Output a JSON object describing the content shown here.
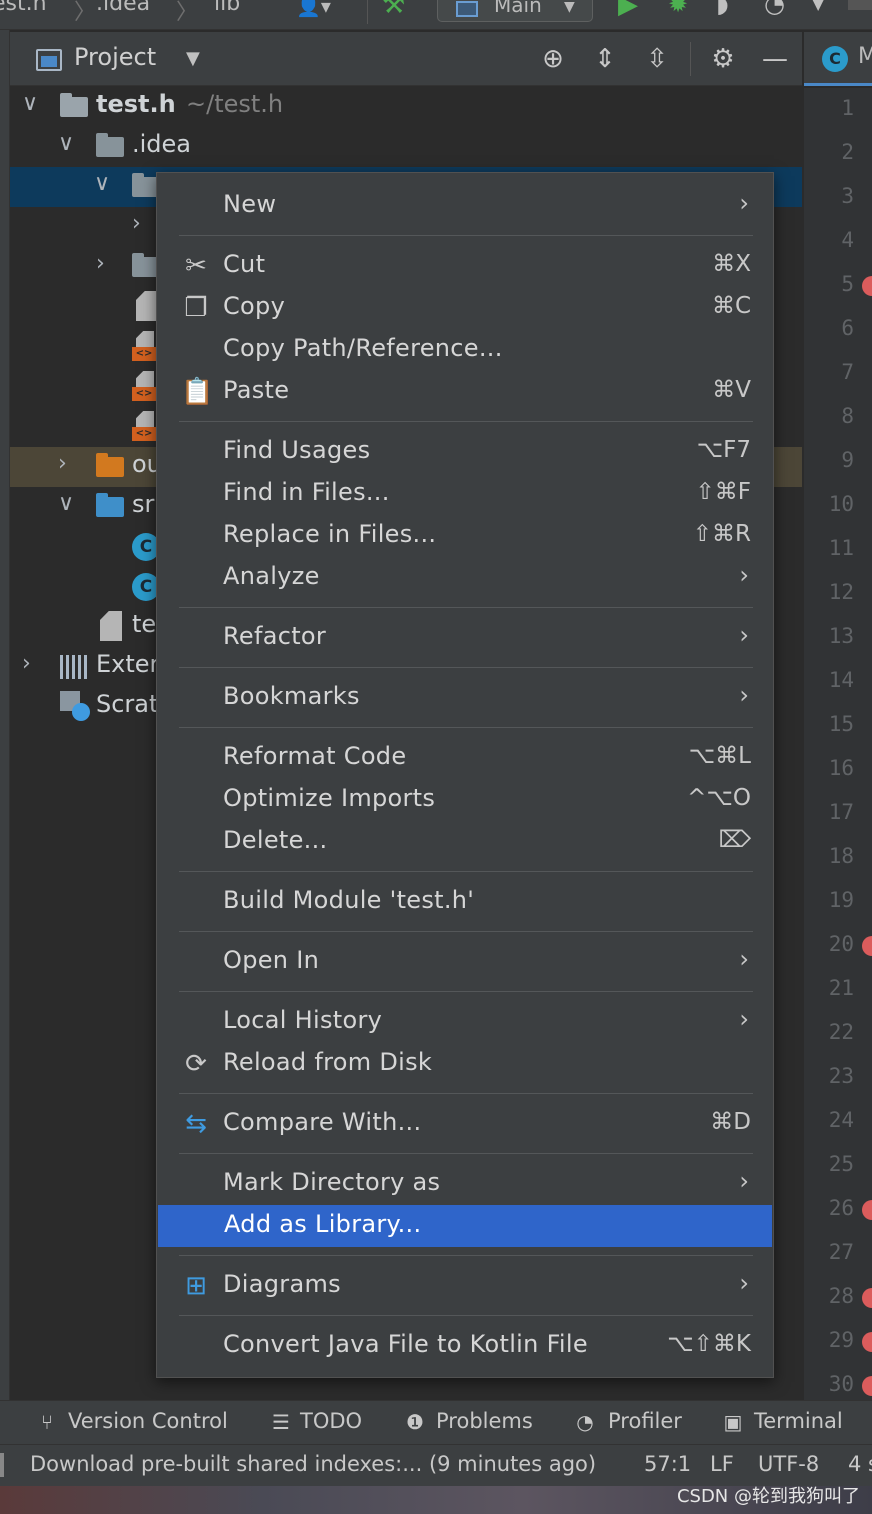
{
  "navbar": {
    "crumbs": [
      "est.h",
      ".idea",
      "lib"
    ],
    "branch": "Main"
  },
  "project_pane": {
    "title": "Project"
  },
  "tree": {
    "root_name": "test.h",
    "root_path": "~/test.h",
    "idea": ".idea",
    "out": "ou",
    "src": "sr",
    "file_te": "te",
    "external": "Exter",
    "scratches": "Scrat"
  },
  "editor": {
    "tab_letter": "C",
    "tab_label": "M",
    "line_numbers": [
      "1",
      "2",
      "3",
      "4",
      "5",
      "6",
      "7",
      "8",
      "9",
      "10",
      "11",
      "12",
      "13",
      "14",
      "15",
      "16",
      "17",
      "18",
      "19",
      "20",
      "21",
      "22",
      "23",
      "24",
      "25",
      "26",
      "27",
      "28",
      "29",
      "30"
    ]
  },
  "context_menu": {
    "items": [
      {
        "label": "New",
        "shortcut": "",
        "submenu": true
      },
      {
        "label": "Cut",
        "shortcut": "⌘X",
        "icon": "scissors-icon"
      },
      {
        "label": "Copy",
        "shortcut": "⌘C",
        "icon": "copy-icon"
      },
      {
        "label": "Copy Path/Reference...",
        "shortcut": ""
      },
      {
        "label": "Paste",
        "shortcut": "⌘V",
        "icon": "clipboard-icon"
      },
      {
        "label": "Find Usages",
        "shortcut": "⌥F7"
      },
      {
        "label": "Find in Files...",
        "shortcut": "⇧⌘F"
      },
      {
        "label": "Replace in Files...",
        "shortcut": "⇧⌘R"
      },
      {
        "label": "Analyze",
        "submenu": true
      },
      {
        "label": "Refactor",
        "submenu": true
      },
      {
        "label": "Bookmarks",
        "submenu": true
      },
      {
        "label": "Reformat Code",
        "shortcut": "⌥⌘L"
      },
      {
        "label": "Optimize Imports",
        "shortcut": "^⌥O"
      },
      {
        "label": "Delete...",
        "shortcut": "⌦"
      },
      {
        "label": "Build Module 'test.h'",
        "shortcut": ""
      },
      {
        "label": "Open In",
        "submenu": true
      },
      {
        "label": "Local History",
        "submenu": true
      },
      {
        "label": "Reload from Disk",
        "icon": "reload-icon"
      },
      {
        "label": "Compare With...",
        "shortcut": "⌘D",
        "icon": "compare-icon"
      },
      {
        "label": "Mark Directory as",
        "submenu": true
      },
      {
        "label": "Add as Library...",
        "active": true
      },
      {
        "label": "Diagrams",
        "submenu": true,
        "icon": "diagram-icon"
      },
      {
        "label": "Convert Java File to Kotlin File",
        "shortcut": "⌥⇧⌘K"
      }
    ],
    "arrow": "›"
  },
  "tool_windows": {
    "version_control": "Version Control",
    "todo": "TODO",
    "problems": "Problems",
    "profiler": "Profiler",
    "terminal": "Terminal"
  },
  "status": {
    "message": "Download pre-built shared indexes:... (9 minutes ago)",
    "position": "57:1",
    "line_sep": "LF",
    "encoding": "UTF-8",
    "indent": "4 s"
  },
  "watermark": "CSDN @轮到我狗叫了",
  "colors": {
    "selection": "#2f65ca",
    "accent_blue": "#4a88c7",
    "run_green": "#4caf50",
    "breakpoint_red": "#db5c5c"
  }
}
